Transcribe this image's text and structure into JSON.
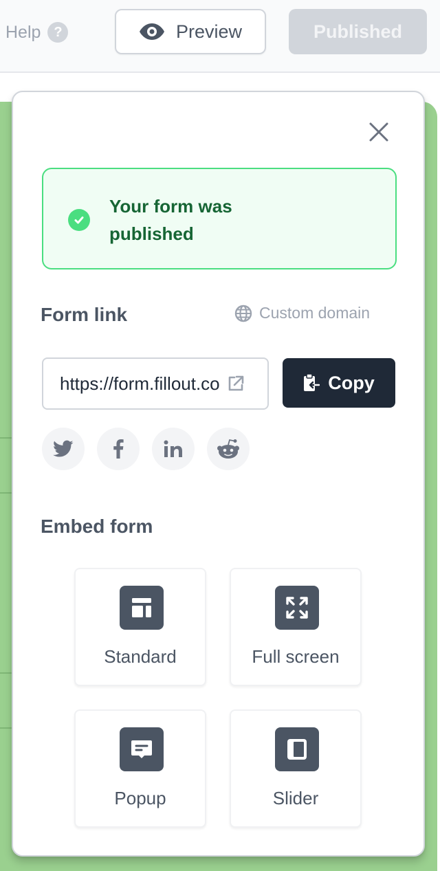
{
  "header": {
    "help_label": "Help",
    "help_icon": "question-circle-icon",
    "preview_label": "Preview",
    "preview_icon": "eye-icon",
    "published_label": "Published"
  },
  "modal": {
    "close_icon": "close-icon",
    "success": {
      "icon": "check-circle-icon",
      "message": "Your form was published"
    },
    "form_link": {
      "title": "Form link",
      "custom_domain_label": "Custom domain",
      "custom_domain_icon": "globe-icon",
      "url_value": "https://form.fillout.com",
      "open_link_icon": "external-link-icon",
      "copy_label": "Copy",
      "copy_icon": "clipboard-icon"
    },
    "share": [
      {
        "name": "twitter",
        "icon": "twitter-icon"
      },
      {
        "name": "facebook",
        "icon": "facebook-icon"
      },
      {
        "name": "linkedin",
        "icon": "linkedin-icon"
      },
      {
        "name": "reddit",
        "icon": "reddit-icon"
      }
    ],
    "embed": {
      "title": "Embed form",
      "options": [
        {
          "label": "Standard",
          "icon": "layout-icon"
        },
        {
          "label": "Full screen",
          "icon": "expand-icon"
        },
        {
          "label": "Popup",
          "icon": "chat-popup-icon"
        },
        {
          "label": "Slider",
          "icon": "side-panel-icon"
        }
      ]
    }
  },
  "colors": {
    "success_green": "#4ade80",
    "success_text": "#166534",
    "copy_button": "#1f2937",
    "background_green": "#9ad08f"
  }
}
